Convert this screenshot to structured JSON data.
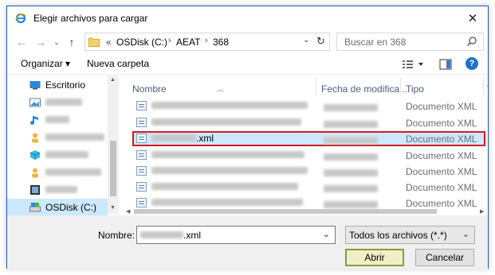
{
  "window": {
    "title": "Elegir archivos para cargar"
  },
  "address": {
    "overflow": "«",
    "crumbs": [
      "OSDisk (C:)",
      "AEAT",
      "368"
    ]
  },
  "search": {
    "placeholder": "Buscar en 368"
  },
  "toolbar": {
    "organize": "Organizar ▾",
    "new_folder": "Nueva carpeta",
    "help": "?"
  },
  "sidebar": {
    "items": [
      {
        "label": "Escritorio",
        "icon": "desktop-icon"
      },
      {
        "label": "",
        "icon": "image-icon"
      },
      {
        "label": "",
        "icon": "music-icon"
      },
      {
        "label": "",
        "icon": "user-icon"
      },
      {
        "label": "",
        "icon": "3d-object-icon"
      },
      {
        "label": "",
        "icon": "user-icon"
      },
      {
        "label": "",
        "icon": "video-icon"
      },
      {
        "label": "OSDisk (C:)",
        "icon": "drive-icon"
      }
    ]
  },
  "columns": {
    "name": "Nombre",
    "date": "Fecha de modifica...",
    "type": "Tipo",
    "extra": "T"
  },
  "files": [
    {
      "name_visible": "",
      "type": "Documento XML",
      "selected": false
    },
    {
      "name_visible": "",
      "type": "Documento XML",
      "selected": false
    },
    {
      "name_visible": ".xml",
      "type": "Documento XML",
      "selected": true
    },
    {
      "name_visible": "",
      "type": "Documento XML",
      "selected": false
    },
    {
      "name_visible": "",
      "type": "Documento XML",
      "selected": false
    },
    {
      "name_visible": "",
      "type": "Documento XML",
      "selected": false
    },
    {
      "name_visible": "",
      "type": "Documento XML",
      "selected": false
    }
  ],
  "bottom": {
    "name_label": "Nombre:",
    "name_value": ".xml",
    "filter_value": "Todos los archivos (*.*)",
    "open_label": "Abrir",
    "cancel_label": "Cancelar"
  },
  "colors": {
    "selection": "#cce8ff",
    "highlight_border": "#d21a24",
    "accent": "#1e72c8"
  }
}
